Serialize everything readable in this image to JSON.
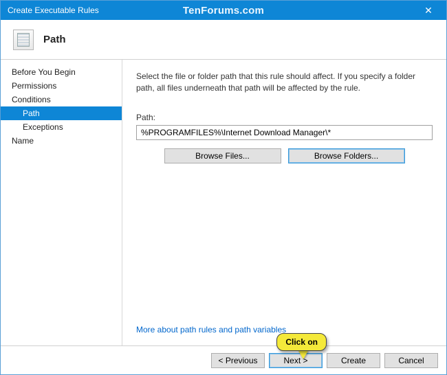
{
  "titlebar": {
    "title": "Create Executable Rules",
    "watermark": "TenForums.com",
    "close_glyph": "✕"
  },
  "header": {
    "heading": "Path"
  },
  "sidebar": {
    "items": [
      {
        "label": "Before You Begin",
        "sub": false,
        "selected": false
      },
      {
        "label": "Permissions",
        "sub": false,
        "selected": false
      },
      {
        "label": "Conditions",
        "sub": false,
        "selected": false
      },
      {
        "label": "Path",
        "sub": true,
        "selected": true
      },
      {
        "label": "Exceptions",
        "sub": true,
        "selected": false
      },
      {
        "label": "Name",
        "sub": false,
        "selected": false
      }
    ]
  },
  "main": {
    "instruction": "Select the file or folder path that this rule should affect. If you specify a folder path, all files underneath that path will be affected by the rule.",
    "path_label": "Path:",
    "path_value": "%PROGRAMFILES%\\Internet Download Manager\\*",
    "browse_files": "Browse Files...",
    "browse_folders": "Browse Folders...",
    "more_link": "More about path rules and path variables"
  },
  "footer": {
    "previous": "< Previous",
    "next": "Next >",
    "create": "Create",
    "cancel": "Cancel"
  },
  "annotation": {
    "callout": "Click on"
  }
}
